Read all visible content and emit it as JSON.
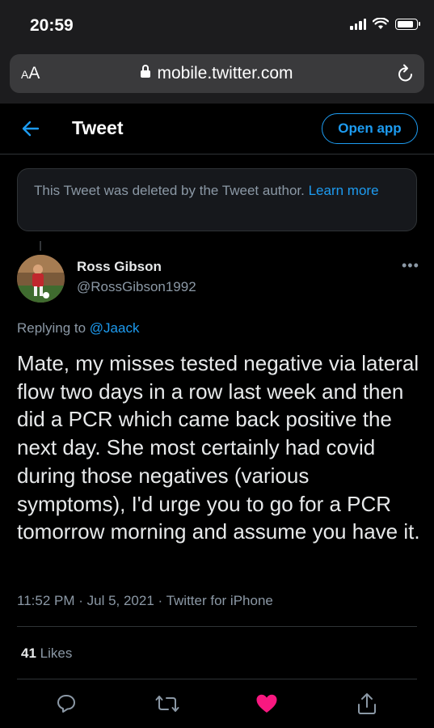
{
  "status_bar": {
    "time": "20:59",
    "battery_level": 0.85
  },
  "browser": {
    "text_size_label_small": "A",
    "text_size_label_large": "A",
    "url": "mobile.twitter.com"
  },
  "header": {
    "title": "Tweet",
    "open_app_label": "Open app"
  },
  "deleted_notice": {
    "text": "This Tweet was deleted by the Tweet author.",
    "link": "Learn more"
  },
  "tweet": {
    "author_name": "Ross Gibson",
    "author_handle": "@RossGibson1992",
    "replying_prefix": "Replying to",
    "replying_to": "@Jaack",
    "text": "Mate, my misses tested negative via lateral flow two days in a row last week and then did a PCR which came back positive the next day. She most certainly had covid during those negatives (various symptoms), I'd urge you to go for a PCR tomorrow morning and assume you have it.",
    "timestamp": "11:52 PM · Jul 5, 2021 · Twitter for iPhone",
    "likes_count": "41",
    "likes_label": "Likes",
    "liked": true
  },
  "colors": {
    "accent": "#1d9bf0",
    "like": "#f91880",
    "muted": "#8b98a5"
  },
  "icons": [
    "back-arrow-icon",
    "lock-icon",
    "reload-icon",
    "more-icon",
    "reply-icon",
    "retweet-icon",
    "heart-icon",
    "share-icon"
  ]
}
